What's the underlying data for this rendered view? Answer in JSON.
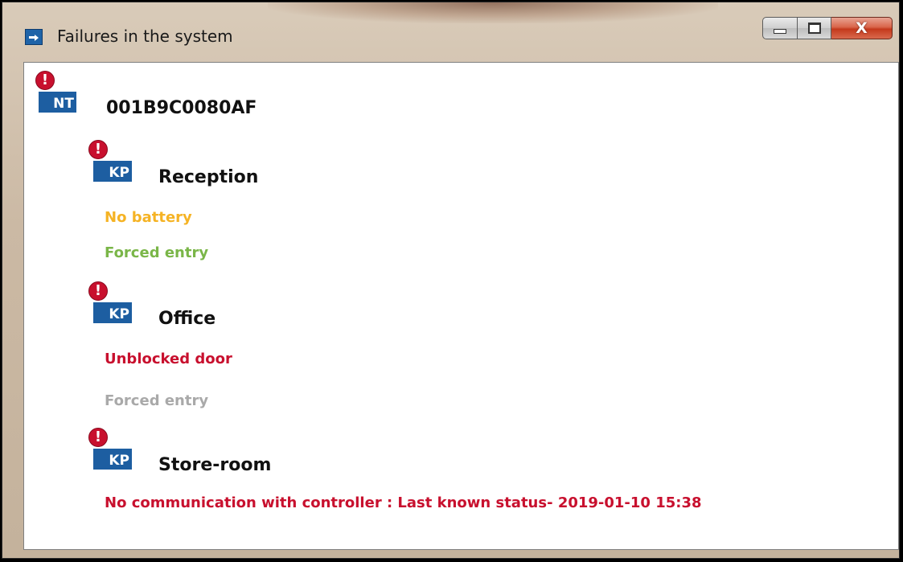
{
  "window": {
    "title": "Failures in the system",
    "icon": "app-icon",
    "buttons": {
      "minimize_icon": "minimize-icon",
      "maximize_icon": "maximize-icon",
      "close_icon": "close-icon",
      "close_glyph": "X"
    }
  },
  "alert_glyph": "!",
  "controller": {
    "badge": "NT",
    "name": "001B9C0080AF"
  },
  "keypads": [
    {
      "badge": "KP",
      "name": "Reception",
      "statuses": [
        {
          "text": "No battery",
          "color": "#f5b324"
        },
        {
          "text": "Forced entry",
          "color": "#7ab648"
        }
      ]
    },
    {
      "badge": "KP",
      "name": "Office",
      "statuses": [
        {
          "text": "Unblocked door",
          "color": "#c8102e"
        },
        {
          "text": "Forced entry",
          "color": "#a9a9a9"
        }
      ]
    },
    {
      "badge": "KP",
      "name": "Store-room",
      "statuses": [
        {
          "text": "No communication with controller : Last known status- 2019-01-10 15:38",
          "color": "#c8102e"
        }
      ]
    }
  ],
  "colors": {
    "badge_blue": "#1d5ea1",
    "alert_red": "#c8102e"
  }
}
